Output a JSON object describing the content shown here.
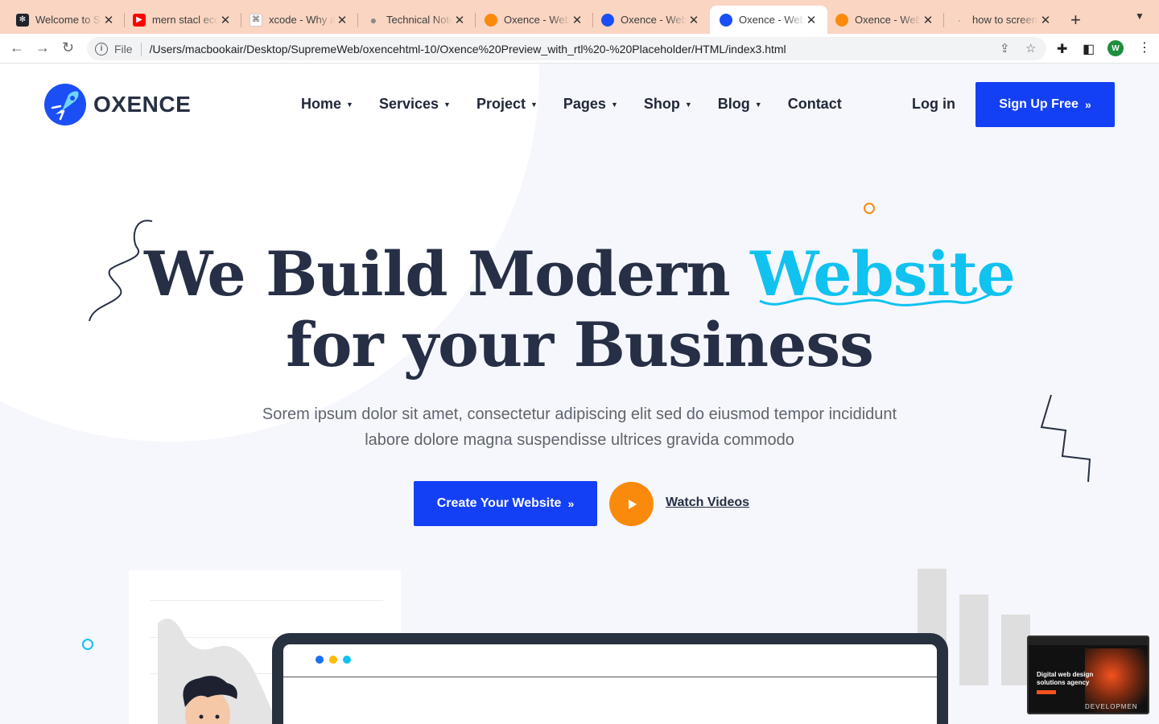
{
  "browser": {
    "tabs": [
      {
        "title": "Welcome to Su",
        "icon": "react-icon",
        "color": "#20232a"
      },
      {
        "title": "mern stacl eco",
        "icon": "youtube-icon",
        "color": "#ff0000"
      },
      {
        "title": "xcode - Why a",
        "icon": "command-icon",
        "color": "#ffffff"
      },
      {
        "title": "Technical Note",
        "icon": "apple-icon",
        "color": "#888888"
      },
      {
        "title": "Oxence - Web",
        "icon": "oxence-orange-icon",
        "color": "#fa8a0c"
      },
      {
        "title": "Oxence - Web",
        "icon": "oxence-blue-icon",
        "color": "#1b4ff5"
      },
      {
        "title": "Oxence - Web",
        "icon": "oxence-blue-icon",
        "color": "#1b4ff5"
      },
      {
        "title": "Oxence - Web",
        "icon": "oxence-orange-icon",
        "color": "#fa8a0c"
      },
      {
        "title": "how to screen",
        "icon": "google-icon",
        "color": "#ffffff"
      }
    ],
    "active_tab": 6,
    "address": {
      "scheme": "File",
      "url": "/Users/macbookair/Desktop/SupremeWeb/oxencehtml-10/Oxence%20Preview_with_rtl%20-%20Placeholder/HTML/index3.html"
    },
    "profile_initial": "W"
  },
  "site": {
    "logo_text": "OXENCE",
    "nav": [
      {
        "label": "Home",
        "dropdown": true
      },
      {
        "label": "Services",
        "dropdown": true
      },
      {
        "label": "Project",
        "dropdown": true
      },
      {
        "label": "Pages",
        "dropdown": true
      },
      {
        "label": "Shop",
        "dropdown": true
      },
      {
        "label": "Blog",
        "dropdown": true
      },
      {
        "label": "Contact",
        "dropdown": false
      }
    ],
    "login_label": "Log in",
    "signup_label": "Sign Up Free",
    "colors": {
      "primary": "#1440f5",
      "accent": "#10c2f0",
      "orange": "#fa8a0c",
      "heading": "#262f45"
    }
  },
  "hero": {
    "line1": "We Build Modern",
    "accent": "Website",
    "line2": "for your Business",
    "subtext_line1": "Sorem ipsum dolor sit amet, consectetur adipiscing elit sed do eiusmod tempor incididunt",
    "subtext_line2": "labore dolore magna suspendisse ultrices gravida commodo",
    "cta_label": "Create Your Website",
    "watch_label": "Watch Videos"
  },
  "pip": {
    "title": "Digital web design solutions agency",
    "brand": "DEVELOPMEN"
  }
}
